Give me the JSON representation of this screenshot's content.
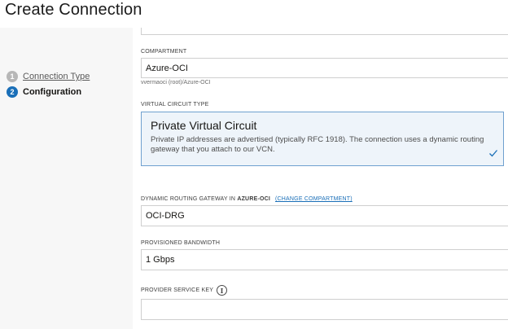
{
  "header": {
    "title": "Create Connection"
  },
  "steps": [
    {
      "number": "1",
      "label": "Connection Type"
    },
    {
      "number": "2",
      "label": "Configuration"
    }
  ],
  "compartment": {
    "label": "COMPARTMENT",
    "value": "Azure-OCI",
    "hint": "vvermaoci (root)/Azure-OCI"
  },
  "virtual_circuit": {
    "label": "VIRTUAL CIRCUIT TYPE",
    "title": "Private Virtual Circuit",
    "description": "Private IP addresses are advertised (typically RFC 1918). The connection uses a dynamic routing gateway that you attach to our VCN."
  },
  "drg": {
    "label_prefix": "DYNAMIC ROUTING GATEWAY IN ",
    "label_compartment": "AZURE-OCI",
    "change_link": "(CHANGE COMPARTMENT)",
    "value": "OCI-DRG"
  },
  "bandwidth": {
    "label": "PROVISIONED BANDWIDTH",
    "value": "1 Gbps"
  },
  "service_key": {
    "label": "PROVIDER SERVICE KEY",
    "info_glyph": "i",
    "value": ""
  },
  "colors": {
    "accent": "#1a6fb8",
    "selected_card_bg": "#eef4fa",
    "selected_card_border": "#6fa0cf"
  }
}
